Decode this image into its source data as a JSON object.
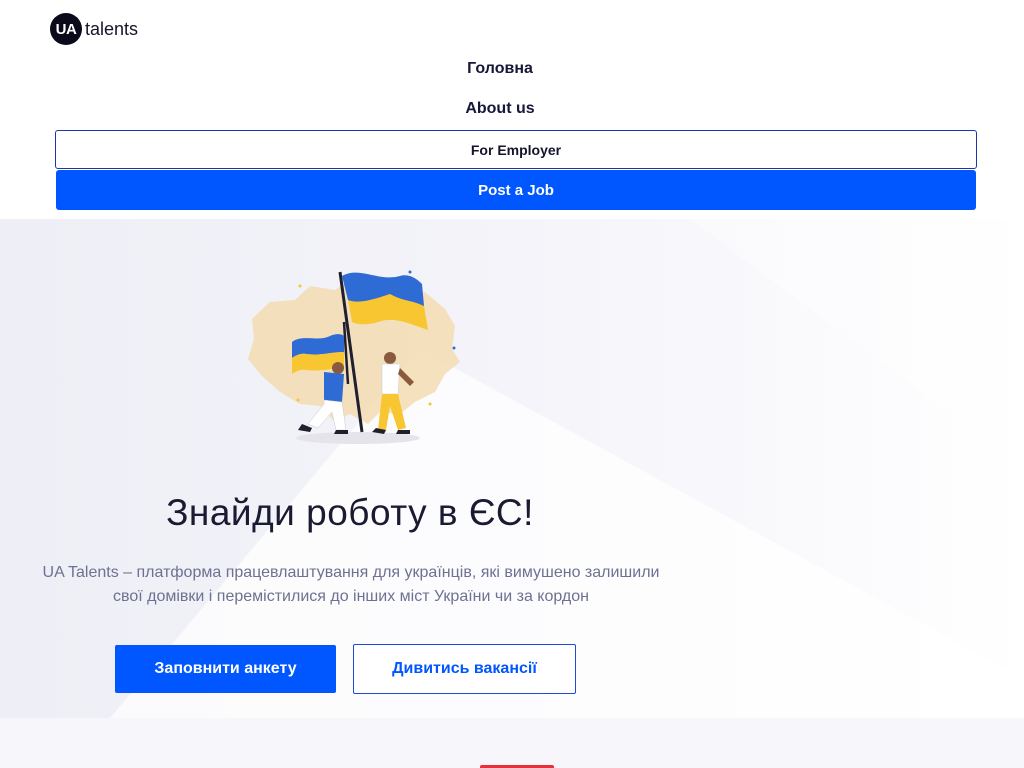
{
  "brand": {
    "badge": "UA",
    "name": "talents"
  },
  "nav": {
    "home": "Головна",
    "about": "About us",
    "employer": "For Employer",
    "post_job": "Post a Job"
  },
  "hero": {
    "title": "Знайди роботу в ЄС!",
    "subtitle": "UA Talents – платформа працевлаштування для українців, які вимушено залишили свої домівки і перемістилися до інших міст України чи за кордон",
    "primary_button": "Заповнити анкету",
    "secondary_button": "Дивитись вакансії",
    "illustration": "people-with-ukrainian-flags-illustration"
  },
  "colors": {
    "accent": "#0057ff",
    "flag_blue": "#2f6bd4",
    "flag_yellow": "#f7c631",
    "text_dark": "#14142b",
    "text_muted": "#6e7191"
  }
}
